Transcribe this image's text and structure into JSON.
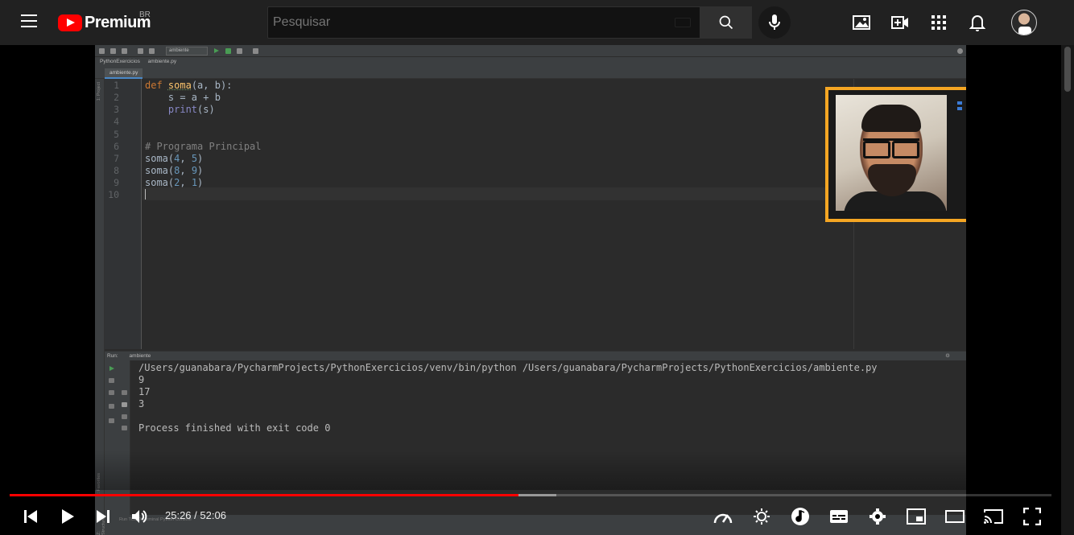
{
  "header": {
    "logo_text": "Premium",
    "country": "BR",
    "search_placeholder": "Pesquisar"
  },
  "ide": {
    "toolbar_config": "ambiente",
    "nav": [
      "PythonExercicios",
      "ambiente.py"
    ],
    "tab": "ambiente.py",
    "side_labels": [
      "1: Project",
      "2: Favorites",
      "Z: Structure"
    ],
    "line_numbers": [
      "1",
      "2",
      "3",
      "4",
      "5",
      "6",
      "7",
      "8",
      "9",
      "10"
    ],
    "code": {
      "l1_kw": "def",
      "l1_fn": "soma",
      "l1_rest": "(a, b):",
      "l2": "    s = a + b",
      "l3_bi": "print",
      "l3_rest": "(s)",
      "l6": "# Programa Principal",
      "l7_name": "soma(",
      "l7_a": "4",
      "l7_b": "5",
      "l8_name": "soma(",
      "l8_a": "8",
      "l8_b": "9",
      "l9_name": "soma(",
      "l9_a": "2",
      "l9_b": "1"
    },
    "run_header": "Run:",
    "run_tab": "ambiente",
    "output": [
      "/Users/guanabara/PycharmProjects/PythonExercicios/venv/bin/python /Users/guanabara/PycharmProjects/PythonExercicios/ambiente.py",
      "9",
      "17",
      "3",
      "",
      "Process finished with exit code 0"
    ],
    "status": "Run     TODO     Terminal     Python Console"
  },
  "player": {
    "time_current": "25:26",
    "time_total": "52:06",
    "progress_fraction": 0.4884,
    "buffer_fraction": 0.525
  },
  "colors": {
    "accent_red": "#ff0000",
    "webcam_border": "#f5a623"
  }
}
